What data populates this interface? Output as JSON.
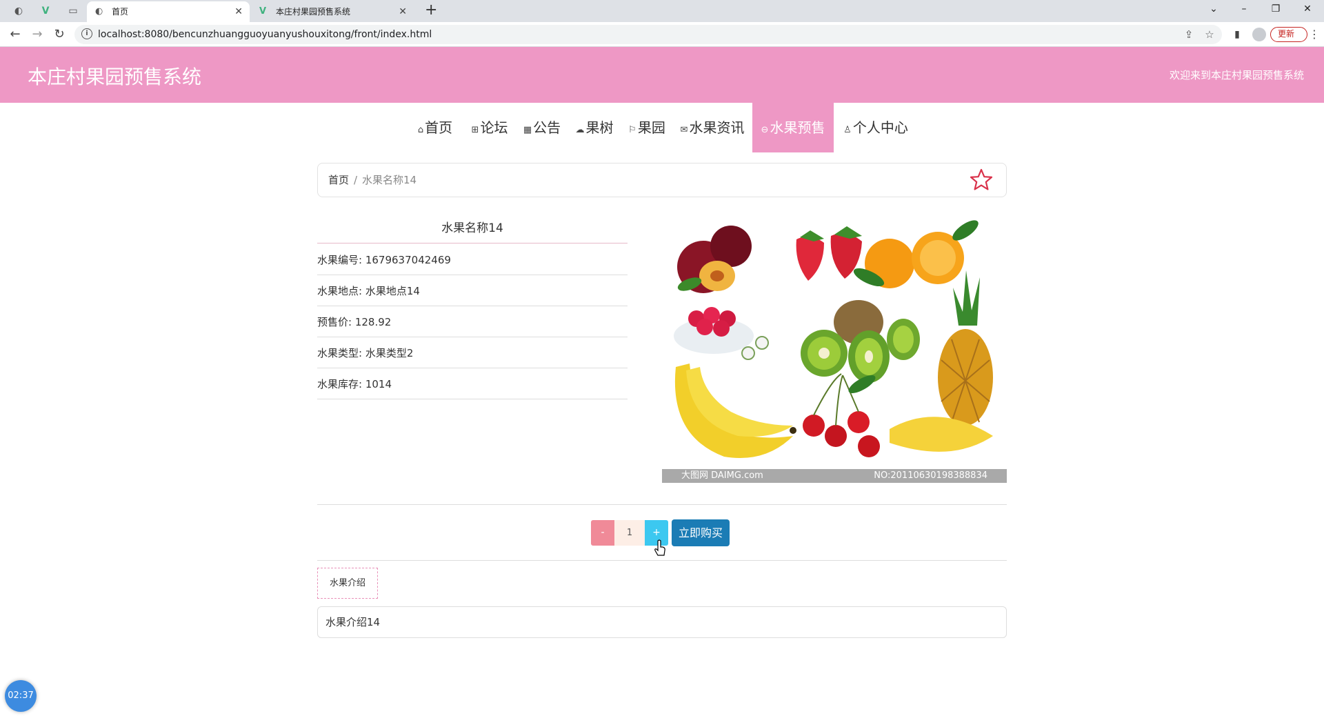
{
  "browser": {
    "tabs": [
      {
        "title": "首页",
        "active": true
      },
      {
        "title": "本庄村果园预售系统",
        "active": false
      }
    ],
    "url": "localhost:8080/bencunzhuangguoyuanyushouxitong/front/index.html",
    "update_label": "更新"
  },
  "site": {
    "title": "本庄村果园预售系统",
    "welcome": "欢迎来到本庄村果园预售系统",
    "accent_color": "#ee98c5"
  },
  "nav": [
    {
      "icon": "home-icon",
      "label": "首页"
    },
    {
      "icon": "forum-icon",
      "label": "论坛"
    },
    {
      "icon": "notice-icon",
      "label": "公告"
    },
    {
      "icon": "tree-icon",
      "label": "果树"
    },
    {
      "icon": "flag-icon",
      "label": "果园"
    },
    {
      "icon": "mail-icon",
      "label": "水果资讯"
    },
    {
      "icon": "presale-icon",
      "label": "水果预售",
      "active": true
    },
    {
      "icon": "user-icon",
      "label": "个人中心"
    }
  ],
  "breadcrumb": {
    "home": "首页",
    "separator": "/",
    "current": "水果名称14"
  },
  "product": {
    "name": "水果名称14",
    "fields": [
      {
        "label": "水果编号",
        "value": "1679637042469"
      },
      {
        "label": "水果地点",
        "value": "水果地点14"
      },
      {
        "label": "预售价",
        "value": "128.92"
      },
      {
        "label": "水果类型",
        "value": "水果类型2"
      },
      {
        "label": "水果库存",
        "value": "1014"
      }
    ],
    "image_watermark_left": "大图网 DAIMG.com",
    "image_watermark_right": "NO:20110630198388834"
  },
  "purchase": {
    "minus": "-",
    "quantity": "1",
    "plus": "+",
    "buy_label": "立即购买"
  },
  "intro": {
    "tab_label": "水果介绍",
    "content": "水果介绍14"
  },
  "timer": "02:37"
}
